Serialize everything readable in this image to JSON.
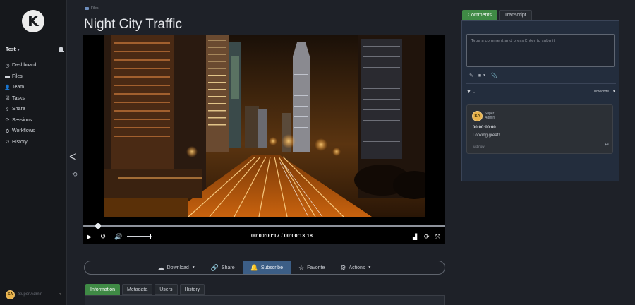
{
  "sidebar": {
    "logo_letter": "K",
    "workspace": "Test",
    "items": [
      {
        "icon": "dashboard-icon",
        "glyph": "◷",
        "label": "Dashboard"
      },
      {
        "icon": "folder-icon",
        "glyph": "▬",
        "label": "Files"
      },
      {
        "icon": "team-icon",
        "glyph": "👤",
        "label": "Team"
      },
      {
        "icon": "tasks-icon",
        "glyph": "☑",
        "label": "Tasks"
      },
      {
        "icon": "share-icon",
        "glyph": "⇪",
        "label": "Share"
      },
      {
        "icon": "sessions-icon",
        "glyph": "⟳",
        "label": "Sessions"
      },
      {
        "icon": "workflows-icon",
        "glyph": "⚙",
        "label": "Workflows"
      },
      {
        "icon": "history-icon",
        "glyph": "↺",
        "label": "History"
      }
    ],
    "user": {
      "initials": "SA",
      "name": "Super Admin"
    }
  },
  "breadcrumb": {
    "label": "Files"
  },
  "page": {
    "title": "Night City Traffic"
  },
  "player": {
    "timecode": "00:00:00:17 / 00:00:13:18",
    "progress": 0.04,
    "volume": 0.95,
    "nav_prev": "<",
    "nav_undo": "⟲"
  },
  "actions": {
    "download": "Download",
    "share": "Share",
    "subscribe": "Subscribe",
    "favorite": "Favorite",
    "actions": "Actions"
  },
  "info_tabs": [
    "Information",
    "Metadata",
    "Users",
    "History"
  ],
  "right_tabs": [
    "Comments",
    "Transcript"
  ],
  "comments": {
    "placeholder": "Type a comment and press Enter to submit",
    "sort_label": "Timecode",
    "items": [
      {
        "initials": "SA",
        "author": "Super Admin",
        "timecode": "00:00:00:00",
        "text": "Looking great!",
        "ago": "just now"
      }
    ]
  },
  "colors": {
    "accent_green": "#3f8a45",
    "accent_blue": "#3c5e86",
    "avatar": "#e8b24a"
  }
}
